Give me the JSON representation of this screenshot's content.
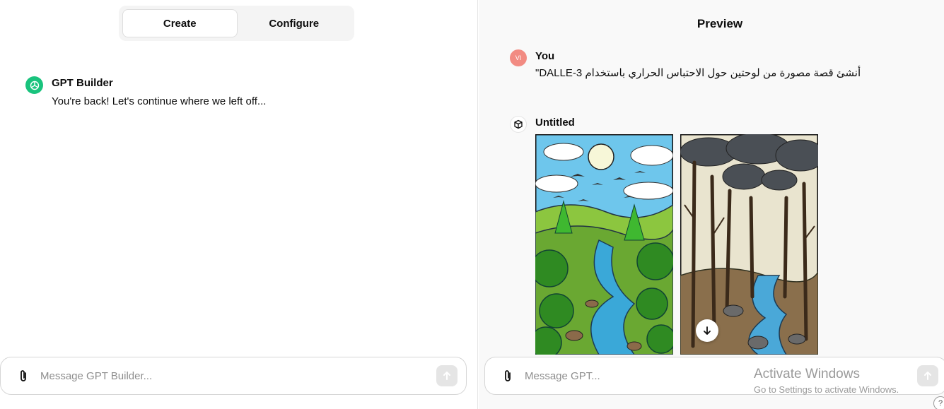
{
  "tabs": [
    {
      "label": "Create",
      "active": true
    },
    {
      "label": "Configure",
      "active": false
    }
  ],
  "builder_message": {
    "author": "GPT Builder",
    "text": "You're back! Let's continue where we left off..."
  },
  "left_composer": {
    "placeholder": "Message GPT Builder...",
    "value": ""
  },
  "preview": {
    "title": "Preview",
    "user_message": {
      "avatar_initials": "VI",
      "author": "You",
      "text": "أنشئ قصة مصورة من لوحتين حول الاحتباس الحراري باستخدام DALLE-3\""
    },
    "gpt_message": {
      "author": "Untitled",
      "icon": "cube-icon"
    },
    "composer": {
      "placeholder": "Message GPT...",
      "value": ""
    }
  },
  "watermark": {
    "title": "Activate Windows",
    "subtitle": "Go to Settings to activate Windows."
  },
  "help_label": "?",
  "colors": {
    "accent_gpt": "#19c37d",
    "avatar_user": "#f28b82",
    "panel_bg": "#f9f9f9"
  }
}
